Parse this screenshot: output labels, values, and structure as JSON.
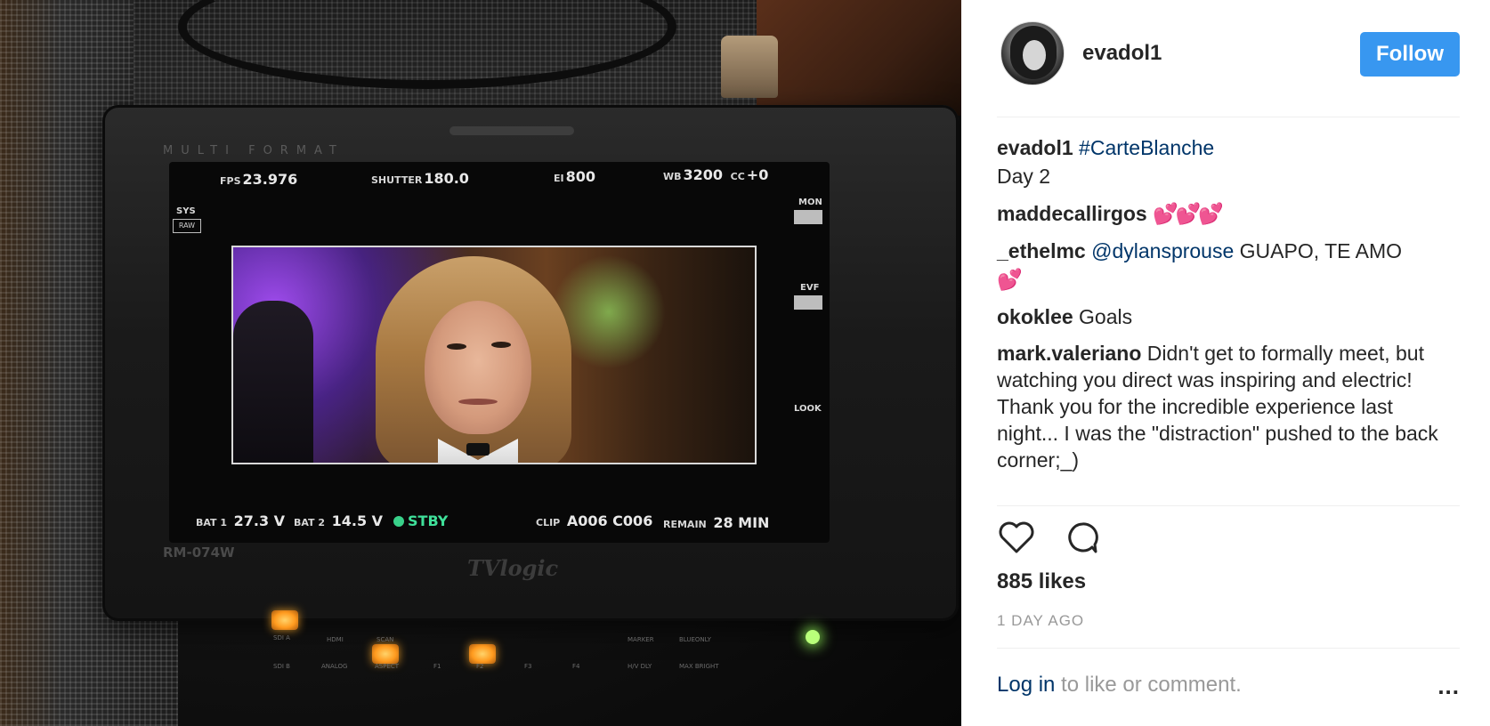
{
  "monitor": {
    "brand": "MULTI FORMAT",
    "model": "RM-074W",
    "logo": "TVlogic",
    "osd": {
      "fps_label": "FPS",
      "fps_value": "23.976",
      "shutter_label": "SHUTTER",
      "shutter_value": "180.0",
      "ei_label": "EI",
      "ei_value": "800",
      "wb_label": "WB",
      "wb_value": "3200",
      "cc_label": "CC",
      "cc_value": "+0",
      "sys_label": "SYS",
      "sys_box": "RAW",
      "mon_label": "MON",
      "evf_label": "EVF",
      "look_label": "LOOK",
      "bat1_label": "BAT 1",
      "bat1_value": "27.3 V",
      "bat2_label": "BAT 2",
      "bat2_value": "14.5 V",
      "status": "STBY",
      "clip_label": "CLIP",
      "clip_value": "A006 C006",
      "remain_label": "REMAIN",
      "remain_value": "28 MIN"
    },
    "controls": [
      "SDI A",
      "HDMI",
      "SCAN",
      "SDI B",
      "ANALOG",
      "ASPECT",
      "F1",
      "F2",
      "F3",
      "F4",
      "MARKER",
      "BLUEONLY",
      "H/V DLY",
      "MAX BRIGHT"
    ]
  },
  "post": {
    "username": "evadol1",
    "follow_label": "Follow",
    "caption": {
      "user": "evadol1",
      "hashtag": "#CarteBlanche",
      "line2": "Day 2"
    },
    "comments": [
      {
        "user": "maddecallirgos",
        "text": "",
        "emoji": "💕💕💕"
      },
      {
        "user": "_ethelmc",
        "mention": "@dylansprouse",
        "text": " GUAPO, TE AMO",
        "emoji": "💕"
      },
      {
        "user": "okoklee",
        "text": " Goals"
      },
      {
        "user": "mark.valeriano",
        "text": " Didn't get to formally meet, but watching you direct was inspiring and electric! Thank you for the incredible experience last night... I was the \"distraction\" pushed to the back corner;_)"
      }
    ],
    "likes": "885 likes",
    "timestamp": "1 DAY AGO",
    "login_link": "Log in",
    "login_text": " to like or comment.",
    "more_label": "..."
  },
  "icons": {
    "like": "heart-icon",
    "comment": "comment-bubble-icon",
    "more": "more-options-icon"
  },
  "colors": {
    "follow_button": "#3897f0",
    "link": "#003569",
    "muted": "#999999",
    "text": "#262626"
  }
}
